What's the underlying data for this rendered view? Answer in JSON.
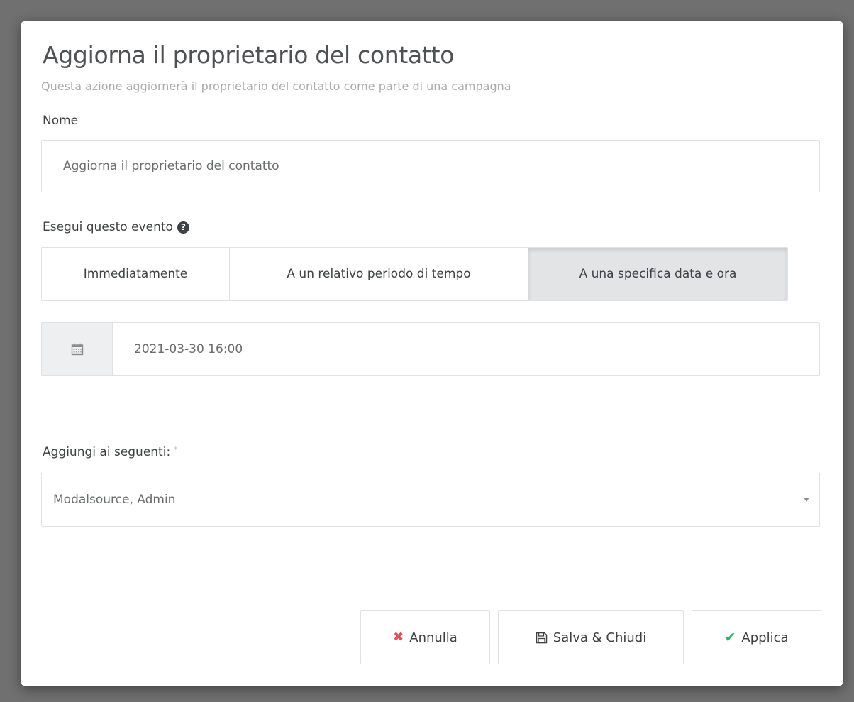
{
  "modal": {
    "title": "Aggiorna il proprietario del contatto",
    "subtitle": "Questa azione aggiornerà il proprietario del contatto come parte di una campagna"
  },
  "form": {
    "name_label": "Nome",
    "name_value": "Aggiorna il proprietario del contatto",
    "exec_label": "Esegui questo evento",
    "exec_help_icon": "question-circle-icon",
    "exec_options": [
      {
        "label": "Immediatamente",
        "active": false
      },
      {
        "label": "A un relativo periodo di tempo",
        "active": false
      },
      {
        "label": "A una specifica data e ora",
        "active": true
      }
    ],
    "date_icon": "calendar-icon",
    "date_value": "2021-03-30 16:00",
    "add_label": "Aggiungi ai seguenti:",
    "required_marker": "*",
    "owner_value": "Modalsource, Admin"
  },
  "footer": {
    "cancel_label": "Annulla",
    "save_label": "Salva & Chiudi",
    "apply_label": "Applica"
  },
  "colors": {
    "cancel_icon": "#e0505a",
    "apply_icon": "#2fb36b",
    "active_option_bg": "#e3e4e6"
  }
}
